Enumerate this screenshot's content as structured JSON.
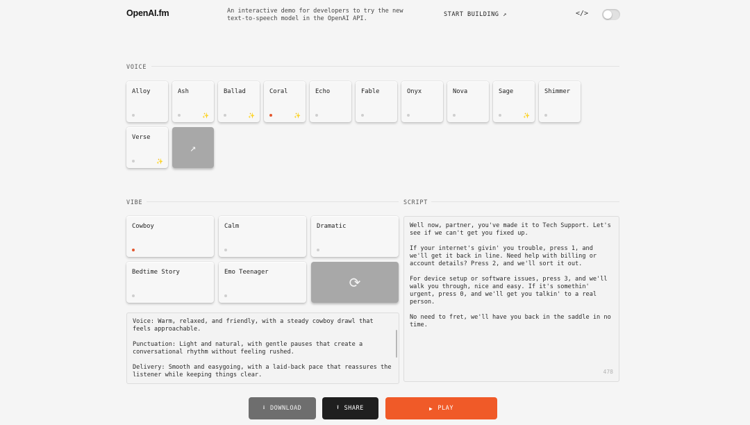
{
  "header": {
    "logo": "OpenAI.fm",
    "tagline": "An interactive demo for developers to try the new text-to-speech model in the OpenAI API.",
    "start_building": "START BUILDING ↗",
    "code_icon": "</>",
    "theme_toggle": "toggle-switch"
  },
  "voice": {
    "label": "VOICE",
    "items": [
      {
        "name": "Alloy",
        "selected": false,
        "sparkle": false
      },
      {
        "name": "Ash",
        "selected": false,
        "sparkle": true
      },
      {
        "name": "Ballad",
        "selected": false,
        "sparkle": true
      },
      {
        "name": "Coral",
        "selected": true,
        "sparkle": true
      },
      {
        "name": "Echo",
        "selected": false,
        "sparkle": false
      },
      {
        "name": "Fable",
        "selected": false,
        "sparkle": false
      },
      {
        "name": "Onyx",
        "selected": false,
        "sparkle": false
      },
      {
        "name": "Nova",
        "selected": false,
        "sparkle": false
      },
      {
        "name": "Sage",
        "selected": false,
        "sparkle": true
      },
      {
        "name": "Shimmer",
        "selected": false,
        "sparkle": false
      },
      {
        "name": "Verse",
        "selected": false,
        "sparkle": true
      }
    ],
    "random_icon": "↗",
    "sparkle_glyph": "✨"
  },
  "vibe": {
    "label": "VIBE",
    "items": [
      {
        "name": "Cowboy",
        "selected": true
      },
      {
        "name": "Calm",
        "selected": false
      },
      {
        "name": "Dramatic",
        "selected": false
      },
      {
        "name": "Bedtime Story",
        "selected": false
      },
      {
        "name": "Emo Teenager",
        "selected": false
      }
    ],
    "shuffle_icon": "⟳",
    "description": [
      "Voice: Warm, relaxed, and friendly, with a steady cowboy drawl that feels approachable.",
      "Punctuation: Light and natural, with gentle pauses that create a conversational rhythm without feeling rushed.",
      "Delivery: Smooth and easygoing, with a laid-back pace that reassures the listener while keeping things clear."
    ]
  },
  "script": {
    "label": "SCRIPT",
    "paragraphs": [
      "Well now, partner, you've made it to Tech Support. Let's see if we can't get you fixed up.",
      "If your internet's givin' you trouble, press 1, and we'll get it back in line. Need help with billing or account details? Press 2, and we'll sort it out.",
      "For device setup or software issues, press 3, and we'll walk you through, nice and easy. If it's somethin' urgent, press 0, and we'll get you talkin' to a real person.",
      "No need to fret, we'll have you back in the saddle in no time."
    ],
    "char_count": "478"
  },
  "actions": {
    "download": "DOWNLOAD",
    "share": "SHARE",
    "play": "PLAY",
    "download_icon": "⭳",
    "share_icon": "⭱",
    "play_icon": "▶"
  },
  "colors": {
    "accent": "#f05a28",
    "selected_dot": "#e4572e",
    "sparkle": "#d8a41f"
  }
}
